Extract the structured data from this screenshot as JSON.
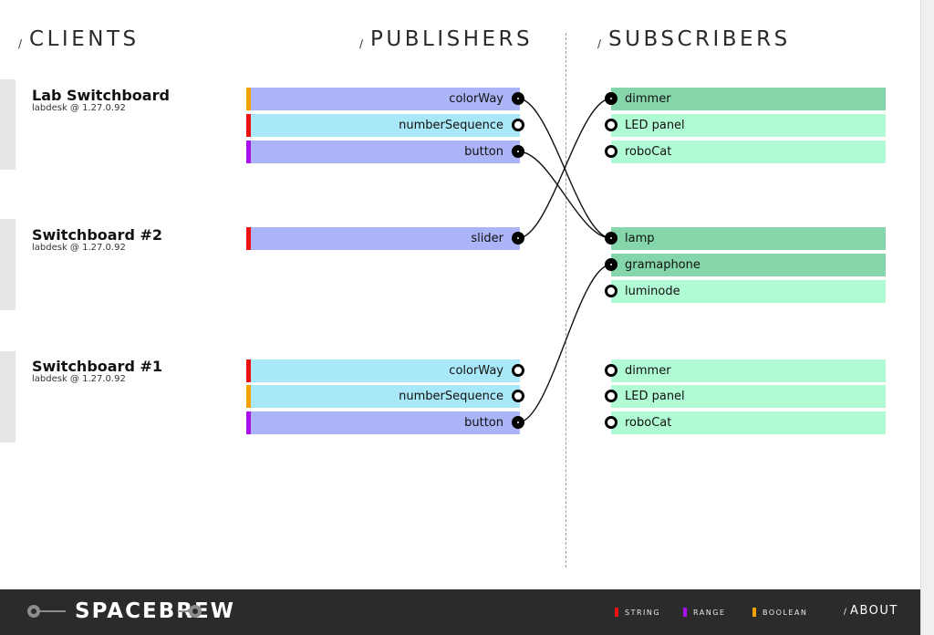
{
  "headers": {
    "slash": "/",
    "clients": "CLIENTS",
    "publishers": "PUBLISHERS",
    "subscribers": "SUBSCRIBERS"
  },
  "colors": {
    "string": "#ee1111",
    "range": "#aa11ee",
    "boolean": "#f5a200",
    "publisher_active": "#aab4f7",
    "publisher_idle": "#a9e8f8",
    "subscriber_active": "#85d6aa",
    "subscriber_idle": "#b0fbd4"
  },
  "clients": [
    {
      "name": "Lab Switchboard",
      "address": "labdesk @ 1.27.0.92",
      "publishers": [
        {
          "label": "colorWay",
          "type": "boolean",
          "connected": true
        },
        {
          "label": "numberSequence",
          "type": "string",
          "connected": false
        },
        {
          "label": "button",
          "type": "range",
          "connected": true
        }
      ],
      "subscribers": [
        {
          "label": "dimmer",
          "connected": true
        },
        {
          "label": "LED panel",
          "connected": false
        },
        {
          "label": "roboCat",
          "connected": false
        }
      ]
    },
    {
      "name": "Switchboard #2",
      "address": "labdesk @ 1.27.0.92",
      "publishers": [
        {
          "label": "slider",
          "type": "string",
          "connected": true
        }
      ],
      "subscribers": [
        {
          "label": "lamp",
          "connected": true
        },
        {
          "label": "gramaphone",
          "connected": true
        },
        {
          "label": "luminode",
          "connected": false
        }
      ]
    },
    {
      "name": "Switchboard #1",
      "address": "labdesk @ 1.27.0.92",
      "publishers": [
        {
          "label": "colorWay",
          "type": "string",
          "connected": false
        },
        {
          "label": "numberSequence",
          "type": "boolean",
          "connected": false
        },
        {
          "label": "button",
          "type": "range",
          "connected": true
        }
      ],
      "subscribers": [
        {
          "label": "dimmer",
          "connected": false
        },
        {
          "label": "LED panel",
          "connected": false
        },
        {
          "label": "roboCat",
          "connected": false
        }
      ]
    }
  ],
  "routes": [
    {
      "from": [
        "clients",
        0,
        "publishers",
        0
      ],
      "to": [
        "clients",
        1,
        "subscribers",
        0
      ]
    },
    {
      "from": [
        "clients",
        0,
        "publishers",
        2
      ],
      "to": [
        "clients",
        1,
        "subscribers",
        0
      ]
    },
    {
      "from": [
        "clients",
        1,
        "publishers",
        0
      ],
      "to": [
        "clients",
        0,
        "subscribers",
        0
      ]
    },
    {
      "from": [
        "clients",
        2,
        "publishers",
        2
      ],
      "to": [
        "clients",
        1,
        "subscribers",
        1
      ]
    }
  ],
  "footer": {
    "logo": "SPACEBREW",
    "legend": [
      {
        "label": "STRING",
        "type": "string"
      },
      {
        "label": "RANGE",
        "type": "range"
      },
      {
        "label": "BOOLEAN",
        "type": "boolean"
      }
    ],
    "about": "ABOUT"
  }
}
